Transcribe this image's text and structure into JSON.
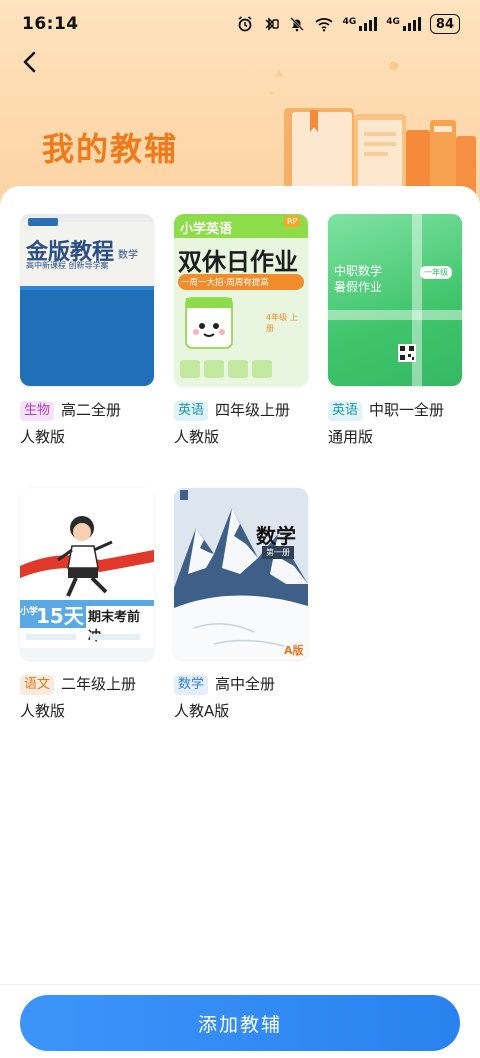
{
  "status_bar": {
    "time": "16:14",
    "network_label": "4G",
    "battery": "84"
  },
  "header": {
    "title": "我的教辅"
  },
  "books": [
    {
      "subject": "生物",
      "grade": "高二全册",
      "edition": "人教版",
      "tag_color": "#b33ec9",
      "cover": {
        "title": "金版教程",
        "subject": "数学",
        "subtitle": "高中新课程 创新导学案"
      }
    },
    {
      "subject": "英语",
      "grade": "四年级上册",
      "edition": "人教版",
      "tag_color": "#1e9aa8",
      "cover": {
        "top": "小学英语",
        "title": "双休日作业",
        "banner": "一周一大招·周周有提高",
        "note": "4年级 上册",
        "badge": "RP"
      }
    },
    {
      "subject": "英语",
      "grade": "中职一全册",
      "edition": "通用版",
      "tag_color": "#1e9aa8",
      "cover": {
        "title": "中职数学",
        "subtitle": "暑假作业",
        "badge": "一年级"
      }
    },
    {
      "subject": "语文",
      "grade": "二年级上册",
      "edition": "人教版",
      "tag_color": "#e0781f",
      "cover": {
        "left": "小学",
        "big": "15天",
        "title": "期末考前冲"
      }
    },
    {
      "subject": "数学",
      "grade": "高中全册",
      "edition": "人教A版",
      "tag_color": "#2f7ed8",
      "cover": {
        "title": "数学",
        "volume": "第一册",
        "mark": "A版"
      }
    }
  ],
  "bottom": {
    "add_button": "添加教辅"
  },
  "colors": {
    "accent": "#2a82f0",
    "title": "#f07a1a",
    "header_bg": "#fde3bf"
  }
}
